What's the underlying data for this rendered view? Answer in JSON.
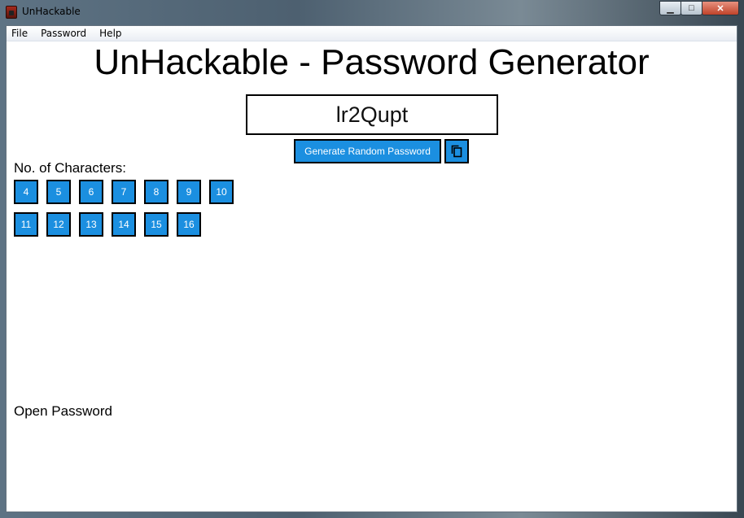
{
  "window": {
    "title": "UnHackable",
    "controls": {
      "minimize": "▁",
      "maximize": "□",
      "close": "✕"
    }
  },
  "menu": [
    "File",
    "Password",
    "Help"
  ],
  "heading": "UnHackable - Password Generator",
  "password": "lr2Qupt",
  "generate_label": "Generate Random Password",
  "copy_icon": "copy-icon",
  "chars_label": "No. of Characters:",
  "lengths_row1": [
    "4",
    "5",
    "6",
    "7",
    "8",
    "9",
    "10"
  ],
  "lengths_row2": [
    "11",
    "12",
    "13",
    "14",
    "15",
    "16"
  ],
  "open_label": "Open Password",
  "colors": {
    "button": "#1b8fe0",
    "button_text": "#ffffff"
  }
}
